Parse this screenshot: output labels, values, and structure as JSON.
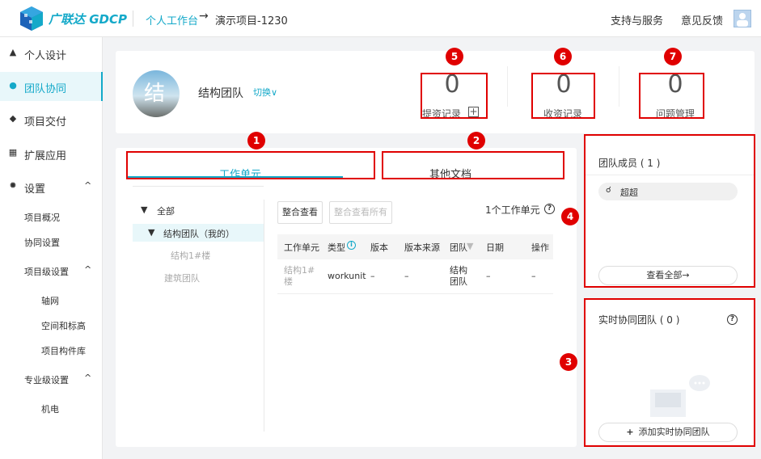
{
  "header": {
    "brand": "广联达 GDCP",
    "breadcrumb": [
      "个人工作台",
      "演示项目-1230"
    ],
    "breadcrumb_arrow": "→",
    "support": "支持与服务",
    "feedback": "意见反馈"
  },
  "sidebar": {
    "items": [
      {
        "label": "个人设计",
        "icon": "user-icon"
      },
      {
        "label": "团队协同",
        "icon": "team-icon",
        "active": true
      },
      {
        "label": "项目交付",
        "icon": "layers-icon"
      },
      {
        "label": "扩展应用",
        "icon": "apps-icon"
      },
      {
        "label": "设置",
        "icon": "gear-icon"
      }
    ],
    "settings_sub": [
      "项目概况",
      "协同设置"
    ],
    "project_settings": {
      "label": "项目级设置",
      "items": [
        "轴网",
        "空间和标高",
        "项目构件库"
      ]
    },
    "pro_settings": {
      "label": "专业级设置",
      "items": [
        "机电"
      ]
    },
    "chevron": "^"
  },
  "team": {
    "avatar_char": "结",
    "name": "结构团队",
    "switch": "切换∨"
  },
  "stats": [
    {
      "value": "0",
      "label": "提资记录",
      "badge": "5"
    },
    {
      "value": "0",
      "label": "收资记录",
      "badge": "6"
    },
    {
      "value": "0",
      "label": "问题管理",
      "badge": "7"
    }
  ],
  "tabs": {
    "active": "工作单元",
    "other": "其他文档"
  },
  "badges": {
    "tab1": "1",
    "tab2": "2",
    "team_live": "3",
    "count": "4"
  },
  "tree": {
    "all": "全部",
    "my_team": "结构团队（我的）",
    "unit": "结构1#楼",
    "other_team": "建筑团队"
  },
  "toolbar": {
    "merge": "整合查看",
    "merge_all": "整合查看所有",
    "count": "1个工作单元"
  },
  "table": {
    "headers": [
      "工作单元",
      "类型",
      "版本",
      "版本来源",
      "团队",
      "日期",
      "操作"
    ],
    "row": {
      "unit": "结构1#楼",
      "type": "workunit",
      "version": "–",
      "source": "–",
      "team": "结构团队",
      "date": "–",
      "op": "–"
    }
  },
  "members": {
    "title": "团队成员 ( 1 )",
    "member": "超超",
    "view_all": "查看全部→"
  },
  "live": {
    "title": "实时协同团队 ( 0 )",
    "add": "添加实时协同团队",
    "plus": "+"
  },
  "colors": {
    "accent": "#14a9c9",
    "red": "#e00000"
  }
}
